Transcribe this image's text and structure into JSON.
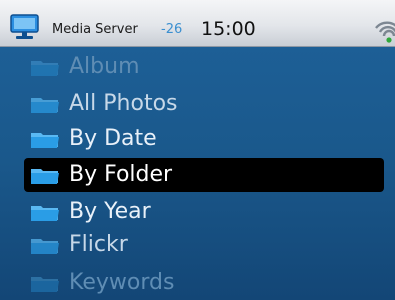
{
  "status_bar": {
    "server_name": "Media Server",
    "signal_value": "-26",
    "time": "15:00",
    "device_icon": "monitor-icon",
    "wifi_icon": "wifi-icon"
  },
  "menu": {
    "items": [
      {
        "label": "Album",
        "icon": "folder-icon",
        "state": "faded"
      },
      {
        "label": "All Photos",
        "icon": "folder-icon",
        "state": "semi"
      },
      {
        "label": "By Date",
        "icon": "folder-icon",
        "state": "normal"
      },
      {
        "label": "By Folder",
        "icon": "folder-icon",
        "state": "selected"
      },
      {
        "label": "By Year",
        "icon": "folder-icon",
        "state": "normal"
      },
      {
        "label": "Flickr",
        "icon": "folder-icon",
        "state": "semi"
      },
      {
        "label": "Keywords",
        "icon": "folder-icon",
        "state": "faded"
      }
    ]
  },
  "colors": {
    "status_bar_background": "#e6e9ed",
    "list_background": "#1b5a8f",
    "selection_background": "#000000",
    "signal_text": "#3b8fd0",
    "folder_icon": "#2a9de6"
  }
}
